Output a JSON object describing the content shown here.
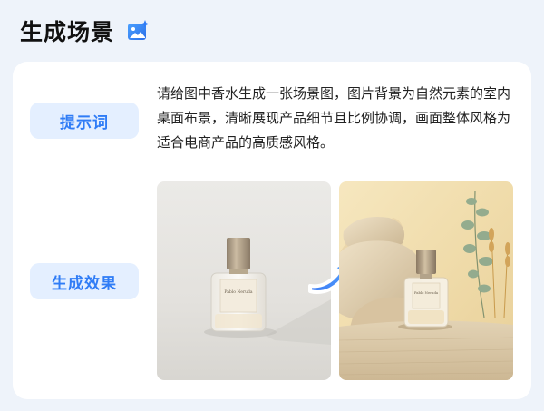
{
  "header": {
    "title": "生成场景",
    "icon": "magic-image-icon"
  },
  "prompt": {
    "label": "提示词",
    "text": "请给图中香水生成一张场景图，图片背景为自然元素的室内桌面布景，清晰展现产品细节且比例协调，画面整体风格为适合电商产品的高质感风格。"
  },
  "result": {
    "label": "生成效果"
  },
  "product": {
    "brand_label": "Pablo Neruda",
    "before_image": "perfume-bottle-plain-background",
    "after_image": "perfume-bottle-natural-scene"
  },
  "colors": {
    "accent": "#2f7cf6",
    "pill_bg": "#e4efff",
    "page_bg": "#eef3fa"
  }
}
